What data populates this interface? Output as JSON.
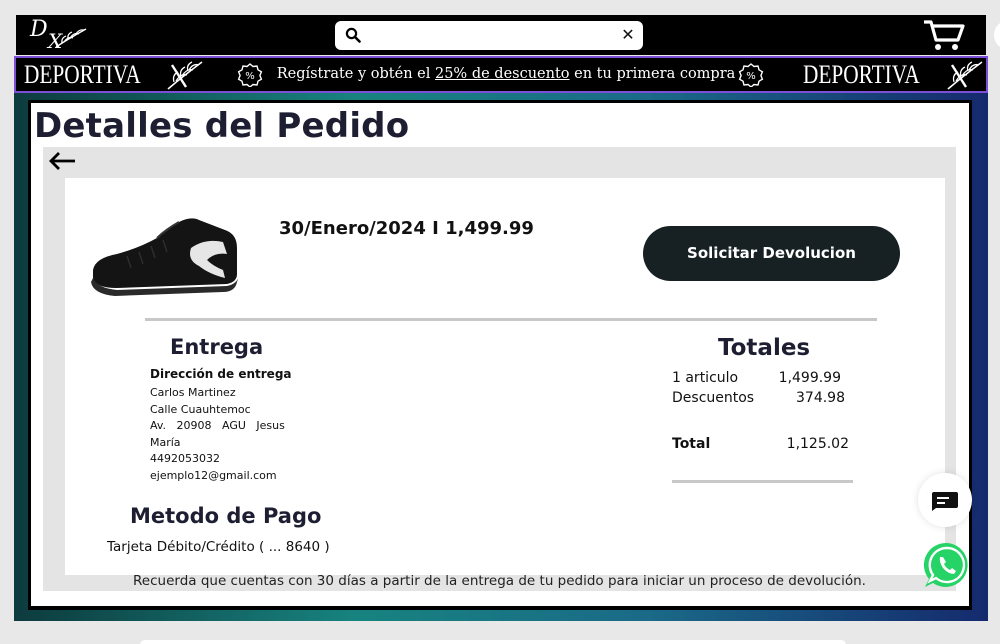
{
  "header": {
    "logo_letters": "DX",
    "search": {
      "value": "",
      "placeholder": "",
      "clear_icon": "close-icon"
    },
    "icons": [
      "search-icon",
      "close-icon",
      "cart-icon"
    ]
  },
  "promo": {
    "brand_left": "DEPORTIVA",
    "brand_right": "DEPORTIVA",
    "text_before": "Regístrate y obtén el ",
    "text_link": "25% de descuento",
    "text_after": " en tu primera compra",
    "pct_icon": "percent-badge-icon"
  },
  "page": {
    "title": "Detalles del Pedido",
    "back_icon": "back-arrow-icon"
  },
  "order": {
    "date_price": "30/Enero/2024 I 1,499.99",
    "product_image": "black-soccer-shoe",
    "return_button": "Solicitar Devolucion"
  },
  "entrega": {
    "heading": "Entrega",
    "address_label": "Dirección de entrega",
    "lines": [
      "Carlos Martinez",
      "Calle Cuauhtemoc",
      "Av.   20908   AGU   Jesus",
      "María",
      "4492053032",
      "ejemplo12@gmail.com"
    ]
  },
  "pago": {
    "heading": "Metodo de Pago",
    "value": "Tarjeta Débito/Crédito ( ... 8640 )"
  },
  "totales": {
    "heading": "Totales",
    "rows": [
      {
        "label": "1 articulo",
        "value": "1,499.99"
      },
      {
        "label": "Descuentos",
        "value": "374.98"
      }
    ],
    "total_label": "Total",
    "total_value": "1,125.02"
  },
  "notice": "Recuerda que cuentas con 30 días a partir de la entrega de tu pedido para iniciar un proceso de devolución.",
  "floating": {
    "chat_icon": "chat-icon",
    "whatsapp_icon": "whatsapp-icon"
  },
  "colors": {
    "header_bg": "#000000",
    "promo_border": "#7b4fd6",
    "button_bg": "#172123",
    "title_color": "#1e1e33",
    "whatsapp_green": "#25d366"
  }
}
